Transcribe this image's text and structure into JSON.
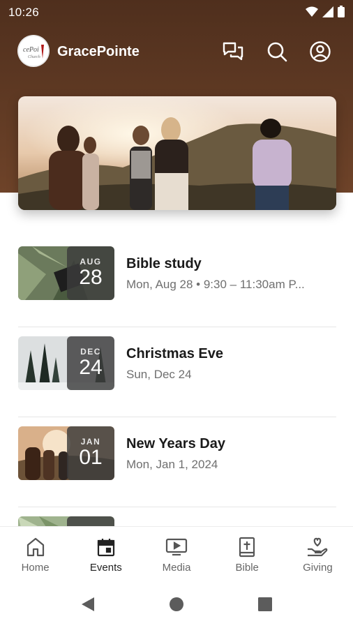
{
  "status_bar": {
    "time": "10:26"
  },
  "app": {
    "name": "GracePointe",
    "logo_text": "cePoi"
  },
  "header_actions": [
    "chat-icon",
    "search-icon",
    "account-icon"
  ],
  "events": [
    {
      "month": "AUG",
      "day": "28",
      "title": "Bible study",
      "subtitle": "Mon, Aug 28 • 9:30 – 11:30am P..."
    },
    {
      "month": "DEC",
      "day": "24",
      "title": "Christmas Eve",
      "subtitle": "Sun, Dec 24"
    },
    {
      "month": "JAN",
      "day": "01",
      "title": "New Years Day",
      "subtitle": "Mon, Jan 1, 2024"
    }
  ],
  "bottom_nav": [
    {
      "label": "Home",
      "icon": "home-icon"
    },
    {
      "label": "Events",
      "icon": "calendar-icon",
      "active": true
    },
    {
      "label": "Media",
      "icon": "media-icon"
    },
    {
      "label": "Bible",
      "icon": "bible-icon"
    },
    {
      "label": "Giving",
      "icon": "giving-icon"
    }
  ],
  "colors": {
    "header": "#5c3822",
    "text_primary": "#1a1a1a",
    "text_secondary": "#6f6f6f"
  }
}
